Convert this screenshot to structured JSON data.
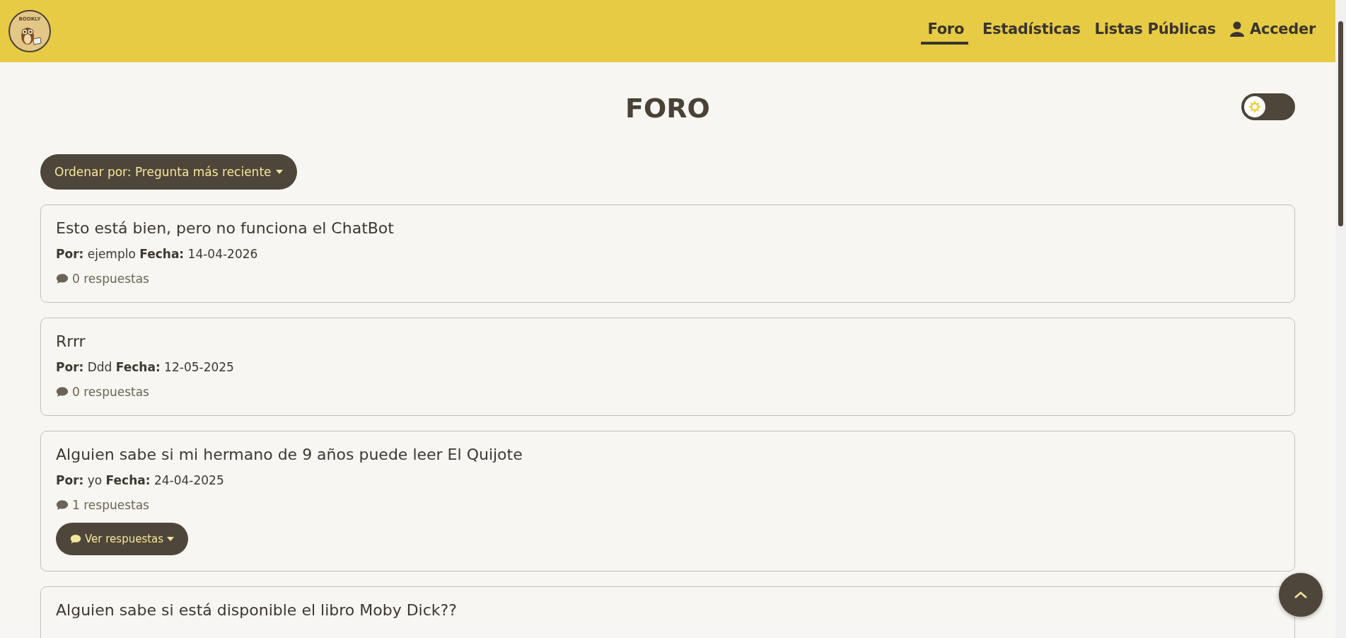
{
  "header": {
    "logo_text": "BOOKLY",
    "nav": [
      {
        "label": "Foro",
        "selected": true,
        "kind": "link"
      },
      {
        "label": "Estadísticas",
        "selected": false,
        "kind": "link"
      },
      {
        "label": "Listas Públicas",
        "selected": false,
        "kind": "link"
      },
      {
        "label": "Acceder",
        "selected": false,
        "kind": "user"
      }
    ]
  },
  "page": {
    "title": "FORO",
    "theme_toggle": {
      "on": false
    },
    "sort_button": "Ordenar por: Pregunta más reciente",
    "questions": [
      {
        "title": "Esto está bien, pero no funciona el ChatBot",
        "author_label": "Por:",
        "author": "ejemplo",
        "date_label": "Fecha:",
        "date": "14-04-2026",
        "replies": "0 respuestas"
      },
      {
        "title": "Rrrr",
        "author_label": "Por:",
        "author": "Ddd",
        "date_label": "Fecha:",
        "date": "12-05-2025",
        "replies": "0 respuestas"
      },
      {
        "title": "Alguien sabe si mi hermano de 9 años puede leer El Quijote",
        "author_label": "Por:",
        "author": "yo",
        "date_label": "Fecha:",
        "date": "24-04-2025",
        "replies": "1 respuestas",
        "replies_button": "Ver respuestas"
      },
      {
        "title": "Alguien sabe si está disponible el libro Moby Dick??"
      }
    ]
  }
}
